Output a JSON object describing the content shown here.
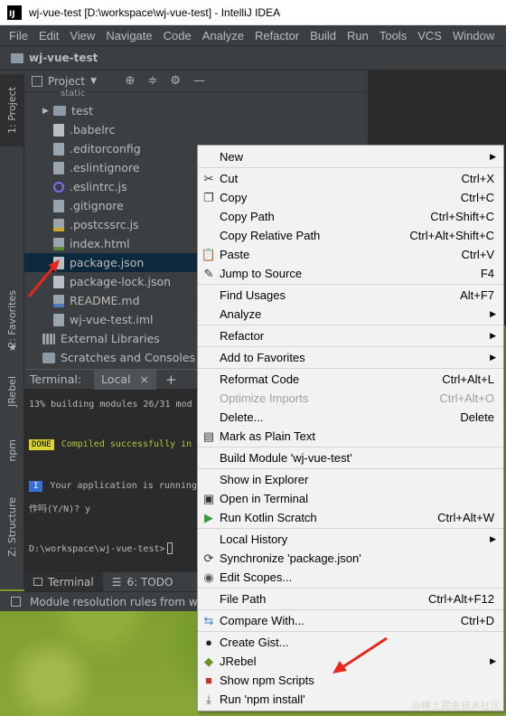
{
  "window": {
    "title": "wj-vue-test [D:\\workspace\\wj-vue-test] - IntelliJ IDEA",
    "logo_text": "IJ"
  },
  "menubar": [
    "File",
    "Edit",
    "View",
    "Navigate",
    "Code",
    "Analyze",
    "Refactor",
    "Build",
    "Run",
    "Tools",
    "VCS",
    "Window",
    "H"
  ],
  "navbar": {
    "project_name": "wj-vue-test"
  },
  "left_strip": {
    "project_tab": "1: Project",
    "favorites_tab": "2: Favorites",
    "jrebel_tab": "JRebel",
    "npm_tab": "npm",
    "structure_tab": "Z: Structure"
  },
  "project_panel": {
    "header": "Project",
    "partial_top": "static",
    "tree": [
      {
        "name": "test",
        "icon": "folder-icon",
        "arrow": "▶"
      },
      {
        "name": ".babelrc",
        "icon": "config-file-icon"
      },
      {
        "name": ".editorconfig",
        "icon": "editorconfig-icon"
      },
      {
        "name": ".eslintignore",
        "icon": "text-file-icon"
      },
      {
        "name": ".eslintrc.js",
        "icon": "eslint-icon"
      },
      {
        "name": ".gitignore",
        "icon": "text-file-icon"
      },
      {
        "name": ".postcssrc.js",
        "icon": "js-file-icon"
      },
      {
        "name": "index.html",
        "icon": "html-file-icon"
      },
      {
        "name": "package.json",
        "icon": "json-file-icon"
      },
      {
        "name": "package-lock.json",
        "icon": "json-file-icon"
      },
      {
        "name": "README.md",
        "icon": "markdown-file-icon"
      },
      {
        "name": "wj-vue-test.iml",
        "icon": "iml-file-icon"
      },
      {
        "name": "External Libraries",
        "icon": "library-icon"
      },
      {
        "name": "Scratches and Consoles",
        "icon": "scratches-icon"
      }
    ]
  },
  "terminal": {
    "label": "Terminal:",
    "tab": "Local",
    "add": "+",
    "line1": "13% building modules 26/31 mod",
    "done_badge": "DONE",
    "done_text": "Compiled successfully in",
    "info_badge": "I",
    "info_text": "Your application is running",
    "prompt_line": "作吗(Y/N)? y",
    "cwd": "D:\\workspace\\wj-vue-test>"
  },
  "bottom_tabs": {
    "terminal": "Terminal",
    "todo": "6: TODO"
  },
  "status": {
    "text": "Module resolution rules from w"
  },
  "context_menu": {
    "items": [
      {
        "type": "item",
        "label": "New",
        "shortcut": "",
        "submenu": true,
        "icon": ""
      },
      {
        "type": "sep"
      },
      {
        "type": "item",
        "label": "Cut",
        "shortcut": "Ctrl+X",
        "icon": "scissors-icon"
      },
      {
        "type": "item",
        "label": "Copy",
        "shortcut": "Ctrl+C",
        "icon": "copy-icon"
      },
      {
        "type": "item",
        "label": "Copy Path",
        "shortcut": "Ctrl+Shift+C",
        "icon": ""
      },
      {
        "type": "item",
        "label": "Copy Relative Path",
        "shortcut": "Ctrl+Alt+Shift+C",
        "icon": ""
      },
      {
        "type": "item",
        "label": "Paste",
        "shortcut": "Ctrl+V",
        "icon": "paste-icon"
      },
      {
        "type": "item",
        "label": "Jump to Source",
        "shortcut": "F4",
        "icon": "pencil-icon"
      },
      {
        "type": "sep"
      },
      {
        "type": "item",
        "label": "Find Usages",
        "shortcut": "Alt+F7",
        "icon": ""
      },
      {
        "type": "item",
        "label": "Analyze",
        "shortcut": "",
        "submenu": true,
        "icon": ""
      },
      {
        "type": "sep"
      },
      {
        "type": "item",
        "label": "Refactor",
        "shortcut": "",
        "submenu": true,
        "icon": ""
      },
      {
        "type": "sep"
      },
      {
        "type": "item",
        "label": "Add to Favorites",
        "shortcut": "",
        "submenu": true,
        "icon": ""
      },
      {
        "type": "sep"
      },
      {
        "type": "item",
        "label": "Reformat Code",
        "shortcut": "Ctrl+Alt+L",
        "icon": ""
      },
      {
        "type": "item",
        "label": "Optimize Imports",
        "shortcut": "Ctrl+Alt+O",
        "disabled": true,
        "icon": ""
      },
      {
        "type": "item",
        "label": "Delete...",
        "shortcut": "Delete",
        "icon": ""
      },
      {
        "type": "item",
        "label": "Mark as Plain Text",
        "shortcut": "",
        "icon": "plain-text-icon"
      },
      {
        "type": "sep"
      },
      {
        "type": "item",
        "label": "Build Module 'wj-vue-test'",
        "shortcut": "",
        "icon": ""
      },
      {
        "type": "sep"
      },
      {
        "type": "item",
        "label": "Show in Explorer",
        "shortcut": "",
        "icon": ""
      },
      {
        "type": "item",
        "label": "Open in Terminal",
        "shortcut": "",
        "icon": "terminal-icon"
      },
      {
        "type": "item",
        "label": "Run Kotlin Scratch",
        "shortcut": "Ctrl+Alt+W",
        "icon": "run-icon"
      },
      {
        "type": "sep"
      },
      {
        "type": "item",
        "label": "Local History",
        "shortcut": "",
        "submenu": true,
        "icon": ""
      },
      {
        "type": "item",
        "label": "Synchronize 'package.json'",
        "shortcut": "",
        "icon": "sync-icon"
      },
      {
        "type": "item",
        "label": "Edit Scopes...",
        "shortcut": "",
        "icon": "scopes-icon"
      },
      {
        "type": "sep"
      },
      {
        "type": "item",
        "label": "File Path",
        "shortcut": "Ctrl+Alt+F12",
        "icon": ""
      },
      {
        "type": "sep"
      },
      {
        "type": "item",
        "label": "Compare With...",
        "shortcut": "Ctrl+D",
        "icon": "compare-icon"
      },
      {
        "type": "sep"
      },
      {
        "type": "item",
        "label": "Create Gist...",
        "shortcut": "",
        "icon": "github-icon"
      },
      {
        "type": "item",
        "label": "JRebel",
        "shortcut": "",
        "submenu": true,
        "icon": "jrebel-icon"
      },
      {
        "type": "item",
        "label": "Show npm Scripts",
        "shortcut": "",
        "icon": "npm-icon"
      },
      {
        "type": "item",
        "label": "Run 'npm install'",
        "shortcut": "",
        "icon": "download-icon"
      }
    ]
  },
  "watermark": "@稀土掘金技术社区",
  "colors": {
    "ide_bg": "#3c3f41",
    "editor_bg": "#2b2b2b",
    "selection": "#0d293e",
    "menu_bg": "#f2f2f2",
    "annotation_arrow": "#e8261b"
  }
}
